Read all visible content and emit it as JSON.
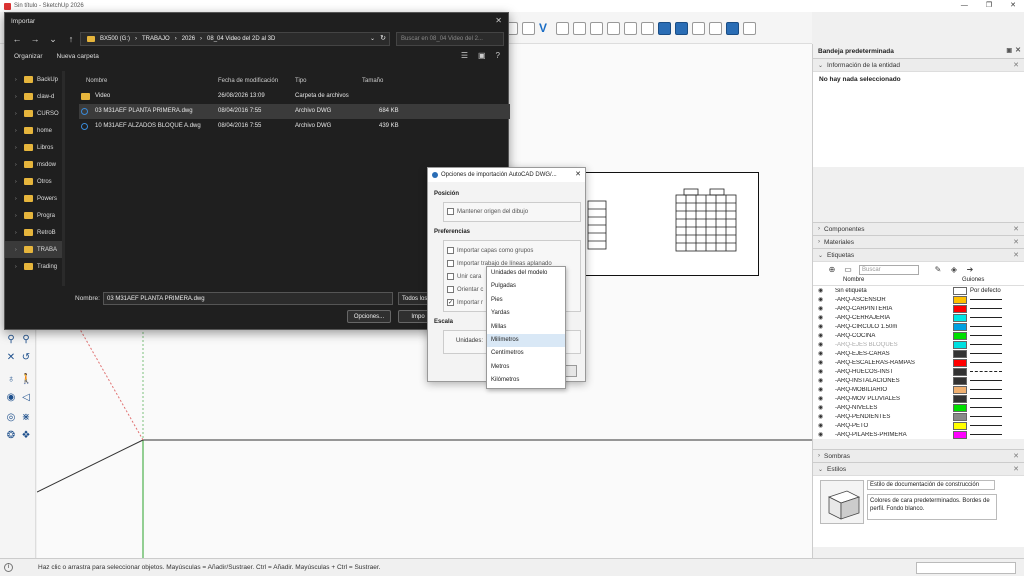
{
  "app": {
    "title": "Sin título - SketchUp 2026"
  },
  "statusbar": {
    "text": "Haz clic o arrastra para seleccionar objetos. Mayúsculas = Añadir/Sustraer. Ctrl = Añadir. Mayúsculas + Ctrl = Sustraer."
  },
  "import_dialog": {
    "title": "Importar",
    "breadcrumb": [
      "BX500 (G:)",
      "TRABAJO",
      "2026",
      "08_04 Video del 2D al 3D"
    ],
    "search_placeholder": "Buscar en 08_04 Video del 2...",
    "organize_label": "Organizar",
    "new_folder_label": "Nueva carpeta",
    "nav_items": [
      {
        "label": "BackUp"
      },
      {
        "label": "claw-d"
      },
      {
        "label": "CURSO"
      },
      {
        "label": "home"
      },
      {
        "label": "Libros"
      },
      {
        "label": "msdow"
      },
      {
        "label": "Otros"
      },
      {
        "label": "Powers"
      },
      {
        "label": "Progra"
      },
      {
        "label": "RetroB"
      },
      {
        "label": "TRABA"
      },
      {
        "label": "Trading"
      }
    ],
    "columns": {
      "name": "Nombre",
      "modified": "Fecha de modificación",
      "type": "Tipo",
      "size": "Tamaño"
    },
    "files": [
      {
        "name": "Video",
        "modified": "26/08/2026 13:09",
        "type": "Carpeta de archivos",
        "size": ""
      },
      {
        "name": "03 M31AEF PLANTA PRIMERA.dwg",
        "modified": "08/04/2016 7:55",
        "type": "Archivo DWG",
        "size": "684 KB"
      },
      {
        "name": "10 M31AEF ALZADOS BLOQUE A.dwg",
        "modified": "08/04/2016 7:55",
        "type": "Archivo DWG",
        "size": "439 KB"
      }
    ],
    "filename_label": "Nombre:",
    "filename_value": "03 M31AEF PLANTA PRIMERA.dwg",
    "filetype_value": "Todos los",
    "options_button": "Opciones...",
    "import_button": "Impo"
  },
  "options_dialog": {
    "title": "Opciones de importación AutoCAD DWG/...",
    "position_section": "Posición",
    "keep_origin": "Mantener origen del dibujo",
    "prefs_section": "Preferencias",
    "pref_items": [
      {
        "label": "Importar capas como grupos",
        "checked": false
      },
      {
        "label": "Importar trabajo de líneas aplanado",
        "checked": false
      },
      {
        "label": "Unir cara",
        "checked": false
      },
      {
        "label": "Orientar c",
        "checked": false
      },
      {
        "label": "Importar r",
        "checked": true
      }
    ],
    "scale_section": "Escala",
    "units_label": "Unidades:",
    "units_options": [
      "Unidades del modelo",
      "Pulgadas",
      "Pies",
      "Yardas",
      "Millas",
      "Milímetros",
      "Centímetros",
      "Metros",
      "Kilómetros"
    ],
    "units_highlighted": "Milímetros"
  },
  "tray": {
    "title": "Bandeja predeterminada",
    "entity_info": "Información de la entidad",
    "entity_empty": "No hay nada seleccionado",
    "components": "Componentes",
    "materials": "Materiales",
    "tags": "Etiquetas",
    "tags_search": "Buscar",
    "tags_col_name": "Nombre",
    "tags_col_dashes": "Guiones",
    "tag_rows": [
      {
        "name": "Sin etiqueta",
        "color": "#ffffff",
        "dash": "Por defecto"
      },
      {
        "name": "-ARQ-ASCENSOR",
        "color": "#ffc000"
      },
      {
        "name": "-ARQ-CARPINTERIA",
        "color": "#ff0000"
      },
      {
        "name": "-ARQ-CERRAJERIA",
        "color": "#00e5e5"
      },
      {
        "name": "-ARQ-CIRCULO 1.50m",
        "color": "#00a0e0"
      },
      {
        "name": "-ARQ-COCINA",
        "color": "#00e000"
      },
      {
        "name": "-ARQ-EJES BLOQUES",
        "color": "#00e0e0",
        "dim": true
      },
      {
        "name": "-ARQ-EJES-CARAS",
        "color": "#333333"
      },
      {
        "name": "-ARQ-ESCALERAS-RAMPAS",
        "color": "#ff0000"
      },
      {
        "name": "-ARQ-HUECOS-INST",
        "color": "#333333",
        "dashed": true
      },
      {
        "name": "-ARQ-INSTALACIONES",
        "color": "#333333"
      },
      {
        "name": "-ARQ-MOBILIARIO",
        "color": "#f0b070"
      },
      {
        "name": "-ARQ-MOV PLUVIALES",
        "color": "#333333"
      },
      {
        "name": "-ARQ-NIVELES",
        "color": "#00e000"
      },
      {
        "name": "-ARQ-PENDIENTES",
        "color": "#888888"
      },
      {
        "name": "-ARQ-PETO",
        "color": "#ffff00"
      },
      {
        "name": "-ARQ-PILARES-PRIMERA",
        "color": "#ff00ff"
      }
    ],
    "shadows": "Sombras",
    "styles": "Estilos",
    "style_name": "Estilo de documentación de construcción",
    "style_desc": "Colores de cara predeterminados. Bordes de perfil. Fondo blanco."
  }
}
